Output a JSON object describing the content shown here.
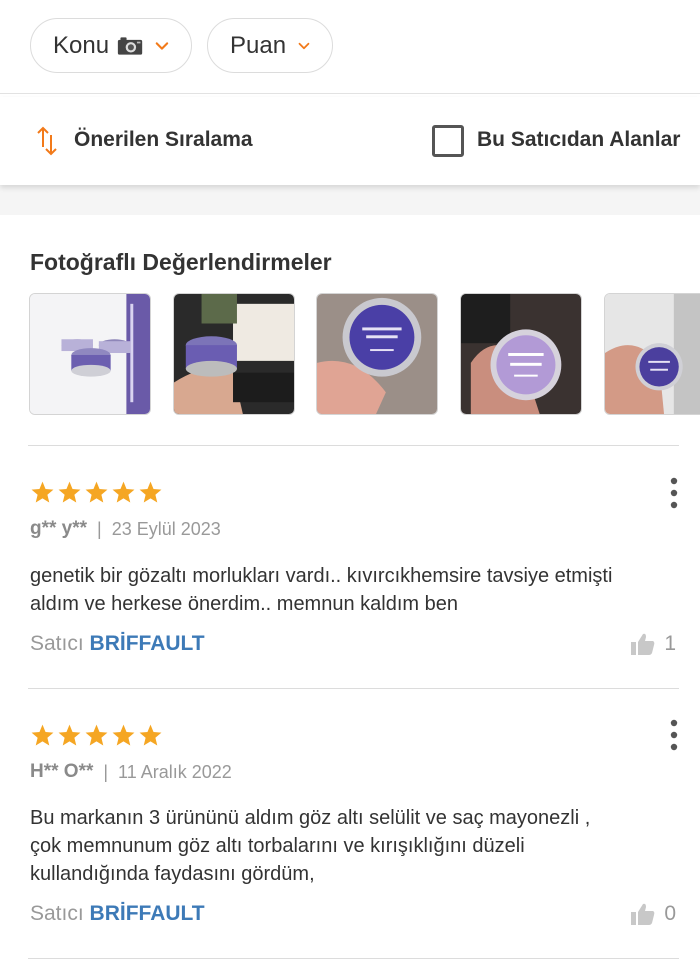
{
  "filters": {
    "topic_label": "Konu",
    "topic_icon": "camera-icon",
    "rating_label": "Puan",
    "accent_color": "#f27a1a"
  },
  "sort": {
    "label": "Önerilen Sıralama",
    "seller_filter_label": "Bu Satıcıdan Alanlar",
    "seller_filter_checked": false
  },
  "photo_reviews": {
    "title": "Fotoğraflı Değerlendirmeler",
    "thumbnails": [
      {
        "icon": "product-photo-icon"
      },
      {
        "icon": "product-photo-icon"
      },
      {
        "icon": "product-photo-icon"
      },
      {
        "icon": "product-photo-icon"
      },
      {
        "icon": "product-photo-icon"
      }
    ]
  },
  "reviews": [
    {
      "stars": 5,
      "author": "g** y**",
      "date": "23 Eylül 2023",
      "text_line1": "genetik bir gözaltı morlukları vardı.. kıvırcıkhemsire tavsiye etmişti",
      "text_line2": "aldım ve herkese önerdim.. memnun kaldım ben",
      "text_line3": "",
      "seller_prefix": "Satıcı",
      "seller_name": "BRİFFAULT",
      "likes": "1"
    },
    {
      "stars": 5,
      "author": "H** O**",
      "date": "11 Aralık 2022",
      "text_line1": "Bu markanın 3 ürününü aldım göz altı selülit ve saç mayonezli ,",
      "text_line2": "çok memnunum göz altı torbalarını ve kırışıklığını düzeli",
      "text_line3": "kullandığında faydasını gördüm,",
      "seller_prefix": "Satıcı",
      "seller_name": "BRİFFAULT",
      "likes": "0"
    }
  ],
  "colors": {
    "star": "#f5a623",
    "seller_link": "#3d7ab7",
    "divider": "#dcdcdc"
  }
}
